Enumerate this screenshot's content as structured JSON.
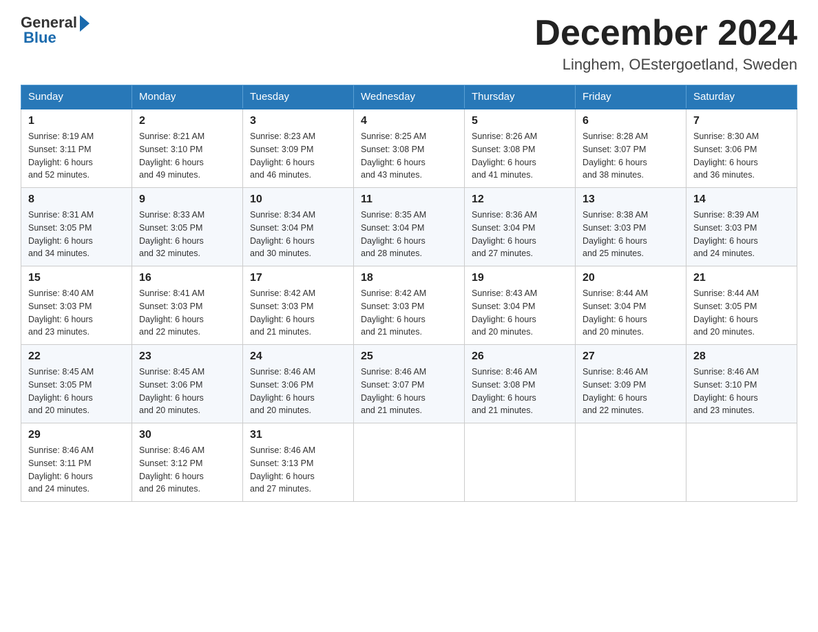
{
  "header": {
    "logo_general": "General",
    "logo_blue": "Blue",
    "month_title": "December 2024",
    "location": "Linghem, OEstergoetland, Sweden"
  },
  "weekdays": [
    "Sunday",
    "Monday",
    "Tuesday",
    "Wednesday",
    "Thursday",
    "Friday",
    "Saturday"
  ],
  "weeks": [
    [
      {
        "day": "1",
        "sunrise": "8:19 AM",
        "sunset": "3:11 PM",
        "daylight": "6 hours and 52 minutes."
      },
      {
        "day": "2",
        "sunrise": "8:21 AM",
        "sunset": "3:10 PM",
        "daylight": "6 hours and 49 minutes."
      },
      {
        "day": "3",
        "sunrise": "8:23 AM",
        "sunset": "3:09 PM",
        "daylight": "6 hours and 46 minutes."
      },
      {
        "day": "4",
        "sunrise": "8:25 AM",
        "sunset": "3:08 PM",
        "daylight": "6 hours and 43 minutes."
      },
      {
        "day": "5",
        "sunrise": "8:26 AM",
        "sunset": "3:08 PM",
        "daylight": "6 hours and 41 minutes."
      },
      {
        "day": "6",
        "sunrise": "8:28 AM",
        "sunset": "3:07 PM",
        "daylight": "6 hours and 38 minutes."
      },
      {
        "day": "7",
        "sunrise": "8:30 AM",
        "sunset": "3:06 PM",
        "daylight": "6 hours and 36 minutes."
      }
    ],
    [
      {
        "day": "8",
        "sunrise": "8:31 AM",
        "sunset": "3:05 PM",
        "daylight": "6 hours and 34 minutes."
      },
      {
        "day": "9",
        "sunrise": "8:33 AM",
        "sunset": "3:05 PM",
        "daylight": "6 hours and 32 minutes."
      },
      {
        "day": "10",
        "sunrise": "8:34 AM",
        "sunset": "3:04 PM",
        "daylight": "6 hours and 30 minutes."
      },
      {
        "day": "11",
        "sunrise": "8:35 AM",
        "sunset": "3:04 PM",
        "daylight": "6 hours and 28 minutes."
      },
      {
        "day": "12",
        "sunrise": "8:36 AM",
        "sunset": "3:04 PM",
        "daylight": "6 hours and 27 minutes."
      },
      {
        "day": "13",
        "sunrise": "8:38 AM",
        "sunset": "3:03 PM",
        "daylight": "6 hours and 25 minutes."
      },
      {
        "day": "14",
        "sunrise": "8:39 AM",
        "sunset": "3:03 PM",
        "daylight": "6 hours and 24 minutes."
      }
    ],
    [
      {
        "day": "15",
        "sunrise": "8:40 AM",
        "sunset": "3:03 PM",
        "daylight": "6 hours and 23 minutes."
      },
      {
        "day": "16",
        "sunrise": "8:41 AM",
        "sunset": "3:03 PM",
        "daylight": "6 hours and 22 minutes."
      },
      {
        "day": "17",
        "sunrise": "8:42 AM",
        "sunset": "3:03 PM",
        "daylight": "6 hours and 21 minutes."
      },
      {
        "day": "18",
        "sunrise": "8:42 AM",
        "sunset": "3:03 PM",
        "daylight": "6 hours and 21 minutes."
      },
      {
        "day": "19",
        "sunrise": "8:43 AM",
        "sunset": "3:04 PM",
        "daylight": "6 hours and 20 minutes."
      },
      {
        "day": "20",
        "sunrise": "8:44 AM",
        "sunset": "3:04 PM",
        "daylight": "6 hours and 20 minutes."
      },
      {
        "day": "21",
        "sunrise": "8:44 AM",
        "sunset": "3:05 PM",
        "daylight": "6 hours and 20 minutes."
      }
    ],
    [
      {
        "day": "22",
        "sunrise": "8:45 AM",
        "sunset": "3:05 PM",
        "daylight": "6 hours and 20 minutes."
      },
      {
        "day": "23",
        "sunrise": "8:45 AM",
        "sunset": "3:06 PM",
        "daylight": "6 hours and 20 minutes."
      },
      {
        "day": "24",
        "sunrise": "8:46 AM",
        "sunset": "3:06 PM",
        "daylight": "6 hours and 20 minutes."
      },
      {
        "day": "25",
        "sunrise": "8:46 AM",
        "sunset": "3:07 PM",
        "daylight": "6 hours and 21 minutes."
      },
      {
        "day": "26",
        "sunrise": "8:46 AM",
        "sunset": "3:08 PM",
        "daylight": "6 hours and 21 minutes."
      },
      {
        "day": "27",
        "sunrise": "8:46 AM",
        "sunset": "3:09 PM",
        "daylight": "6 hours and 22 minutes."
      },
      {
        "day": "28",
        "sunrise": "8:46 AM",
        "sunset": "3:10 PM",
        "daylight": "6 hours and 23 minutes."
      }
    ],
    [
      {
        "day": "29",
        "sunrise": "8:46 AM",
        "sunset": "3:11 PM",
        "daylight": "6 hours and 24 minutes."
      },
      {
        "day": "30",
        "sunrise": "8:46 AM",
        "sunset": "3:12 PM",
        "daylight": "6 hours and 26 minutes."
      },
      {
        "day": "31",
        "sunrise": "8:46 AM",
        "sunset": "3:13 PM",
        "daylight": "6 hours and 27 minutes."
      },
      null,
      null,
      null,
      null
    ]
  ],
  "labels": {
    "sunrise": "Sunrise:",
    "sunset": "Sunset:",
    "daylight": "Daylight:"
  }
}
